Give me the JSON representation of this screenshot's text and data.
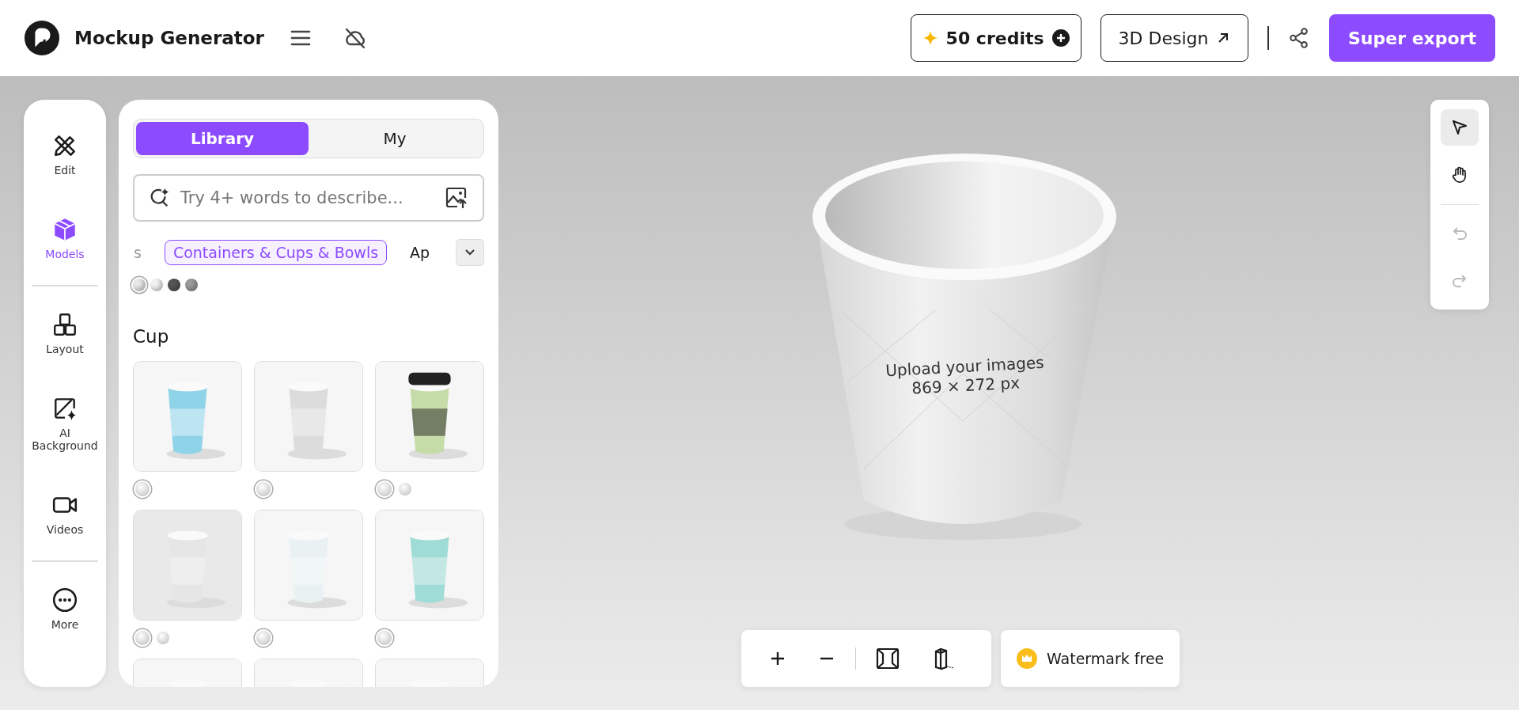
{
  "header": {
    "title": "Mockup Generator",
    "credits": "50 credits",
    "design_button": "3D Design",
    "export_button": "Super export"
  },
  "rail": {
    "items": [
      {
        "label": "Edit",
        "selected": false
      },
      {
        "label": "Models",
        "selected": true
      },
      {
        "label": "Layout",
        "selected": false
      },
      {
        "label": "AI Background",
        "selected": false
      },
      {
        "label": "Videos",
        "selected": false
      },
      {
        "label": "More",
        "selected": false
      }
    ]
  },
  "panel": {
    "tabs": [
      {
        "label": "Library",
        "selected": true
      },
      {
        "label": "My",
        "selected": false
      }
    ],
    "search": {
      "placeholder": "Try 4+ words to describe..."
    },
    "categories": [
      {
        "label": "s",
        "selected": false
      },
      {
        "label": "Containers & Cups & Bowls",
        "selected": true
      },
      {
        "label": "Ap",
        "selected": false
      }
    ],
    "materials": [
      {
        "color": "#e8e8e8",
        "selected": true
      },
      {
        "color": "#f2f2f2",
        "selected": false
      },
      {
        "color": "#555555",
        "selected": false
      },
      {
        "color": "#9a9a9a",
        "selected": false
      }
    ],
    "section_title": "Cup",
    "cards": [
      {
        "kind": "picture",
        "swatches": [
          {
            "selected": true
          }
        ]
      },
      {
        "kind": "picture",
        "swatches": [
          {
            "selected": true
          }
        ]
      },
      {
        "kind": "picture",
        "swatches": [
          {
            "selected": true
          },
          {
            "selected": false
          }
        ]
      },
      {
        "kind": "picture",
        "swatches": [
          {
            "selected": true
          },
          {
            "selected": false
          }
        ]
      },
      {
        "kind": "picture",
        "swatches": [
          {
            "selected": true
          }
        ]
      },
      {
        "kind": "picture",
        "swatches": [
          {
            "selected": true
          }
        ]
      },
      {
        "kind": "picture"
      },
      {
        "kind": "picture"
      },
      {
        "kind": "picture"
      }
    ]
  },
  "canvas": {
    "hint": "Upload your images",
    "size": "869 × 272 px"
  },
  "tools": [
    {
      "selected": true
    },
    {
      "selected": false
    }
  ],
  "history": [
    {
      "disabled": true
    },
    {
      "disabled": true
    }
  ],
  "watermark_button": "Watermark free"
}
